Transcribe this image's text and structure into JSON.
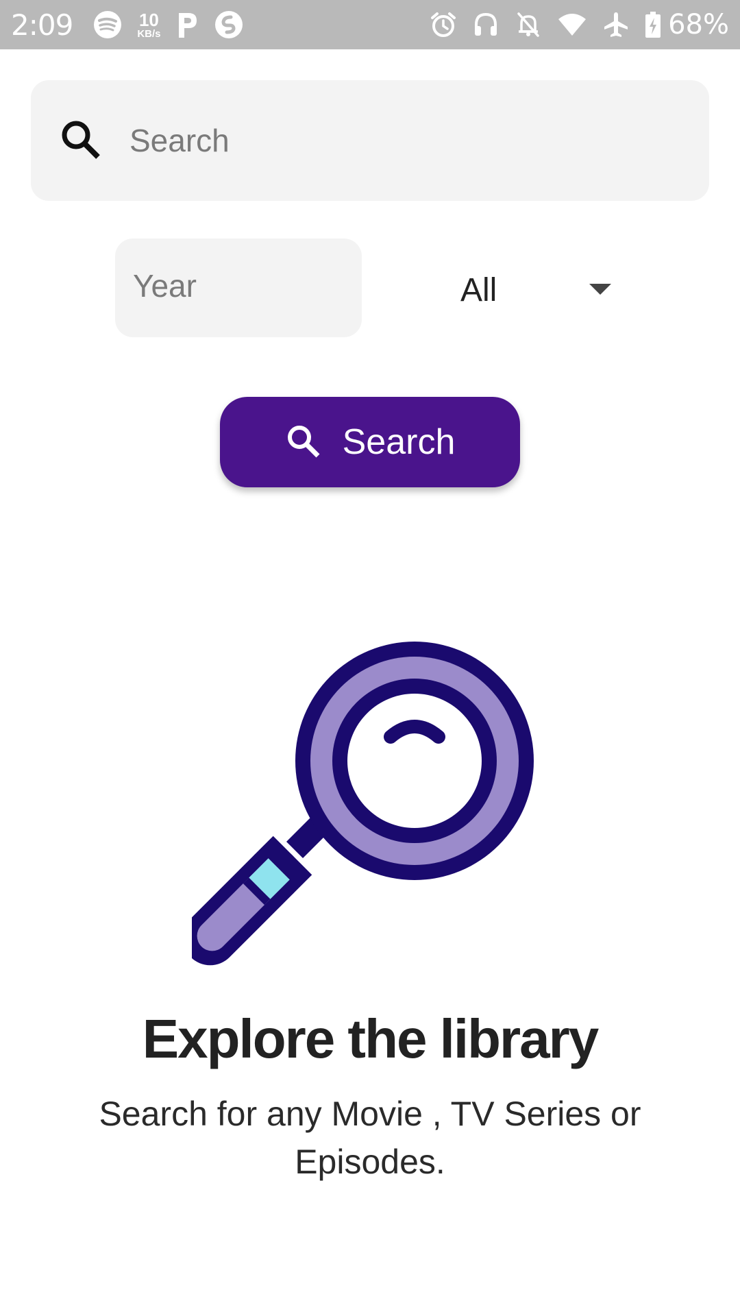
{
  "status_bar": {
    "time": "2:09",
    "net_speed_value": "10",
    "net_speed_unit": "KB/s",
    "battery_percent": "68%",
    "icons_left": [
      "spotify-icon",
      "net-speed",
      "parking-app-icon",
      "shazam-icon"
    ],
    "icons_right": [
      "alarm-icon",
      "headphones-icon",
      "notifications-off-icon",
      "wifi-icon",
      "airplane-mode-icon",
      "battery-charging-icon"
    ]
  },
  "search": {
    "placeholder": "Search",
    "value": ""
  },
  "filters": {
    "year_placeholder": "Year",
    "year_value": "",
    "type_selected": "All"
  },
  "search_button": {
    "label": "Search"
  },
  "empty_state": {
    "title": "Explore the library",
    "subtitle": "Search for any Movie , TV Series or Episodes."
  },
  "colors": {
    "primary": "#4a148c",
    "illustration_dark": "#1a0a6e",
    "illustration_light": "#9b8bcb",
    "illustration_accent": "#8fe3ee",
    "field_background": "#f3f3f3",
    "status_bar": "#b9b9b9"
  }
}
